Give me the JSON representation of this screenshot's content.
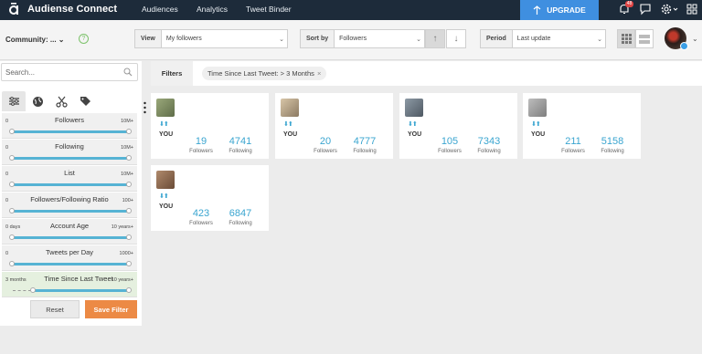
{
  "header": {
    "brand": "Audiense Connect",
    "nav": [
      "Audiences",
      "Analytics",
      "Tweet Binder"
    ],
    "upgrade_label": "UPGRADE",
    "notification_count": "48"
  },
  "toolbar": {
    "community_label": "Community: ...",
    "view_label": "View",
    "view_value": "My followers",
    "sortby_label": "Sort by",
    "sortby_value": "Followers",
    "period_label": "Period",
    "period_value": "Last update"
  },
  "sidebar": {
    "search_placeholder": "Search...",
    "filters": [
      {
        "name": "Followers",
        "min": "0",
        "max": "10M+"
      },
      {
        "name": "Following",
        "min": "0",
        "max": "10M+"
      },
      {
        "name": "List",
        "min": "0",
        "max": "10M+"
      },
      {
        "name": "Followers/Following Ratio",
        "min": "0",
        "max": "100+"
      },
      {
        "name": "Account Age",
        "min": "0 days",
        "max": "10 years+"
      },
      {
        "name": "Tweets per Day",
        "min": "0",
        "max": "1000+"
      },
      {
        "name": "Time Since Last Tweet",
        "min": "3 months",
        "max": "10 years+"
      }
    ],
    "reset_label": "Reset",
    "save_label": "Save Filter"
  },
  "filters_bar": {
    "label": "Filters",
    "chip": "Time Since Last Tweet: > 3 Months"
  },
  "cards": [
    {
      "you": "YOU",
      "followers": "19",
      "following": "4741",
      "followers_label": "Followers",
      "following_label": "Following",
      "avatar_color": "#8a9a6a"
    },
    {
      "you": "YOU",
      "followers": "20",
      "following": "4777",
      "followers_label": "Followers",
      "following_label": "Following",
      "avatar_color": "#c9b79c"
    },
    {
      "you": "YOU",
      "followers": "105",
      "following": "7343",
      "followers_label": "Followers",
      "following_label": "Following",
      "avatar_color": "#7a8a9a"
    },
    {
      "you": "YOU",
      "followers": "211",
      "following": "5158",
      "followers_label": "Followers",
      "following_label": "Following",
      "avatar_color": "#a0a0a0"
    },
    {
      "you": "YOU",
      "followers": "423",
      "following": "6847",
      "followers_label": "Followers",
      "following_label": "Following",
      "avatar_color": "#9b7a60"
    }
  ],
  "colors": {
    "accent": "#3aa5d0",
    "upgrade": "#3f8fe0",
    "save": "#ec8a45",
    "topbar": "#1d2b3a"
  }
}
